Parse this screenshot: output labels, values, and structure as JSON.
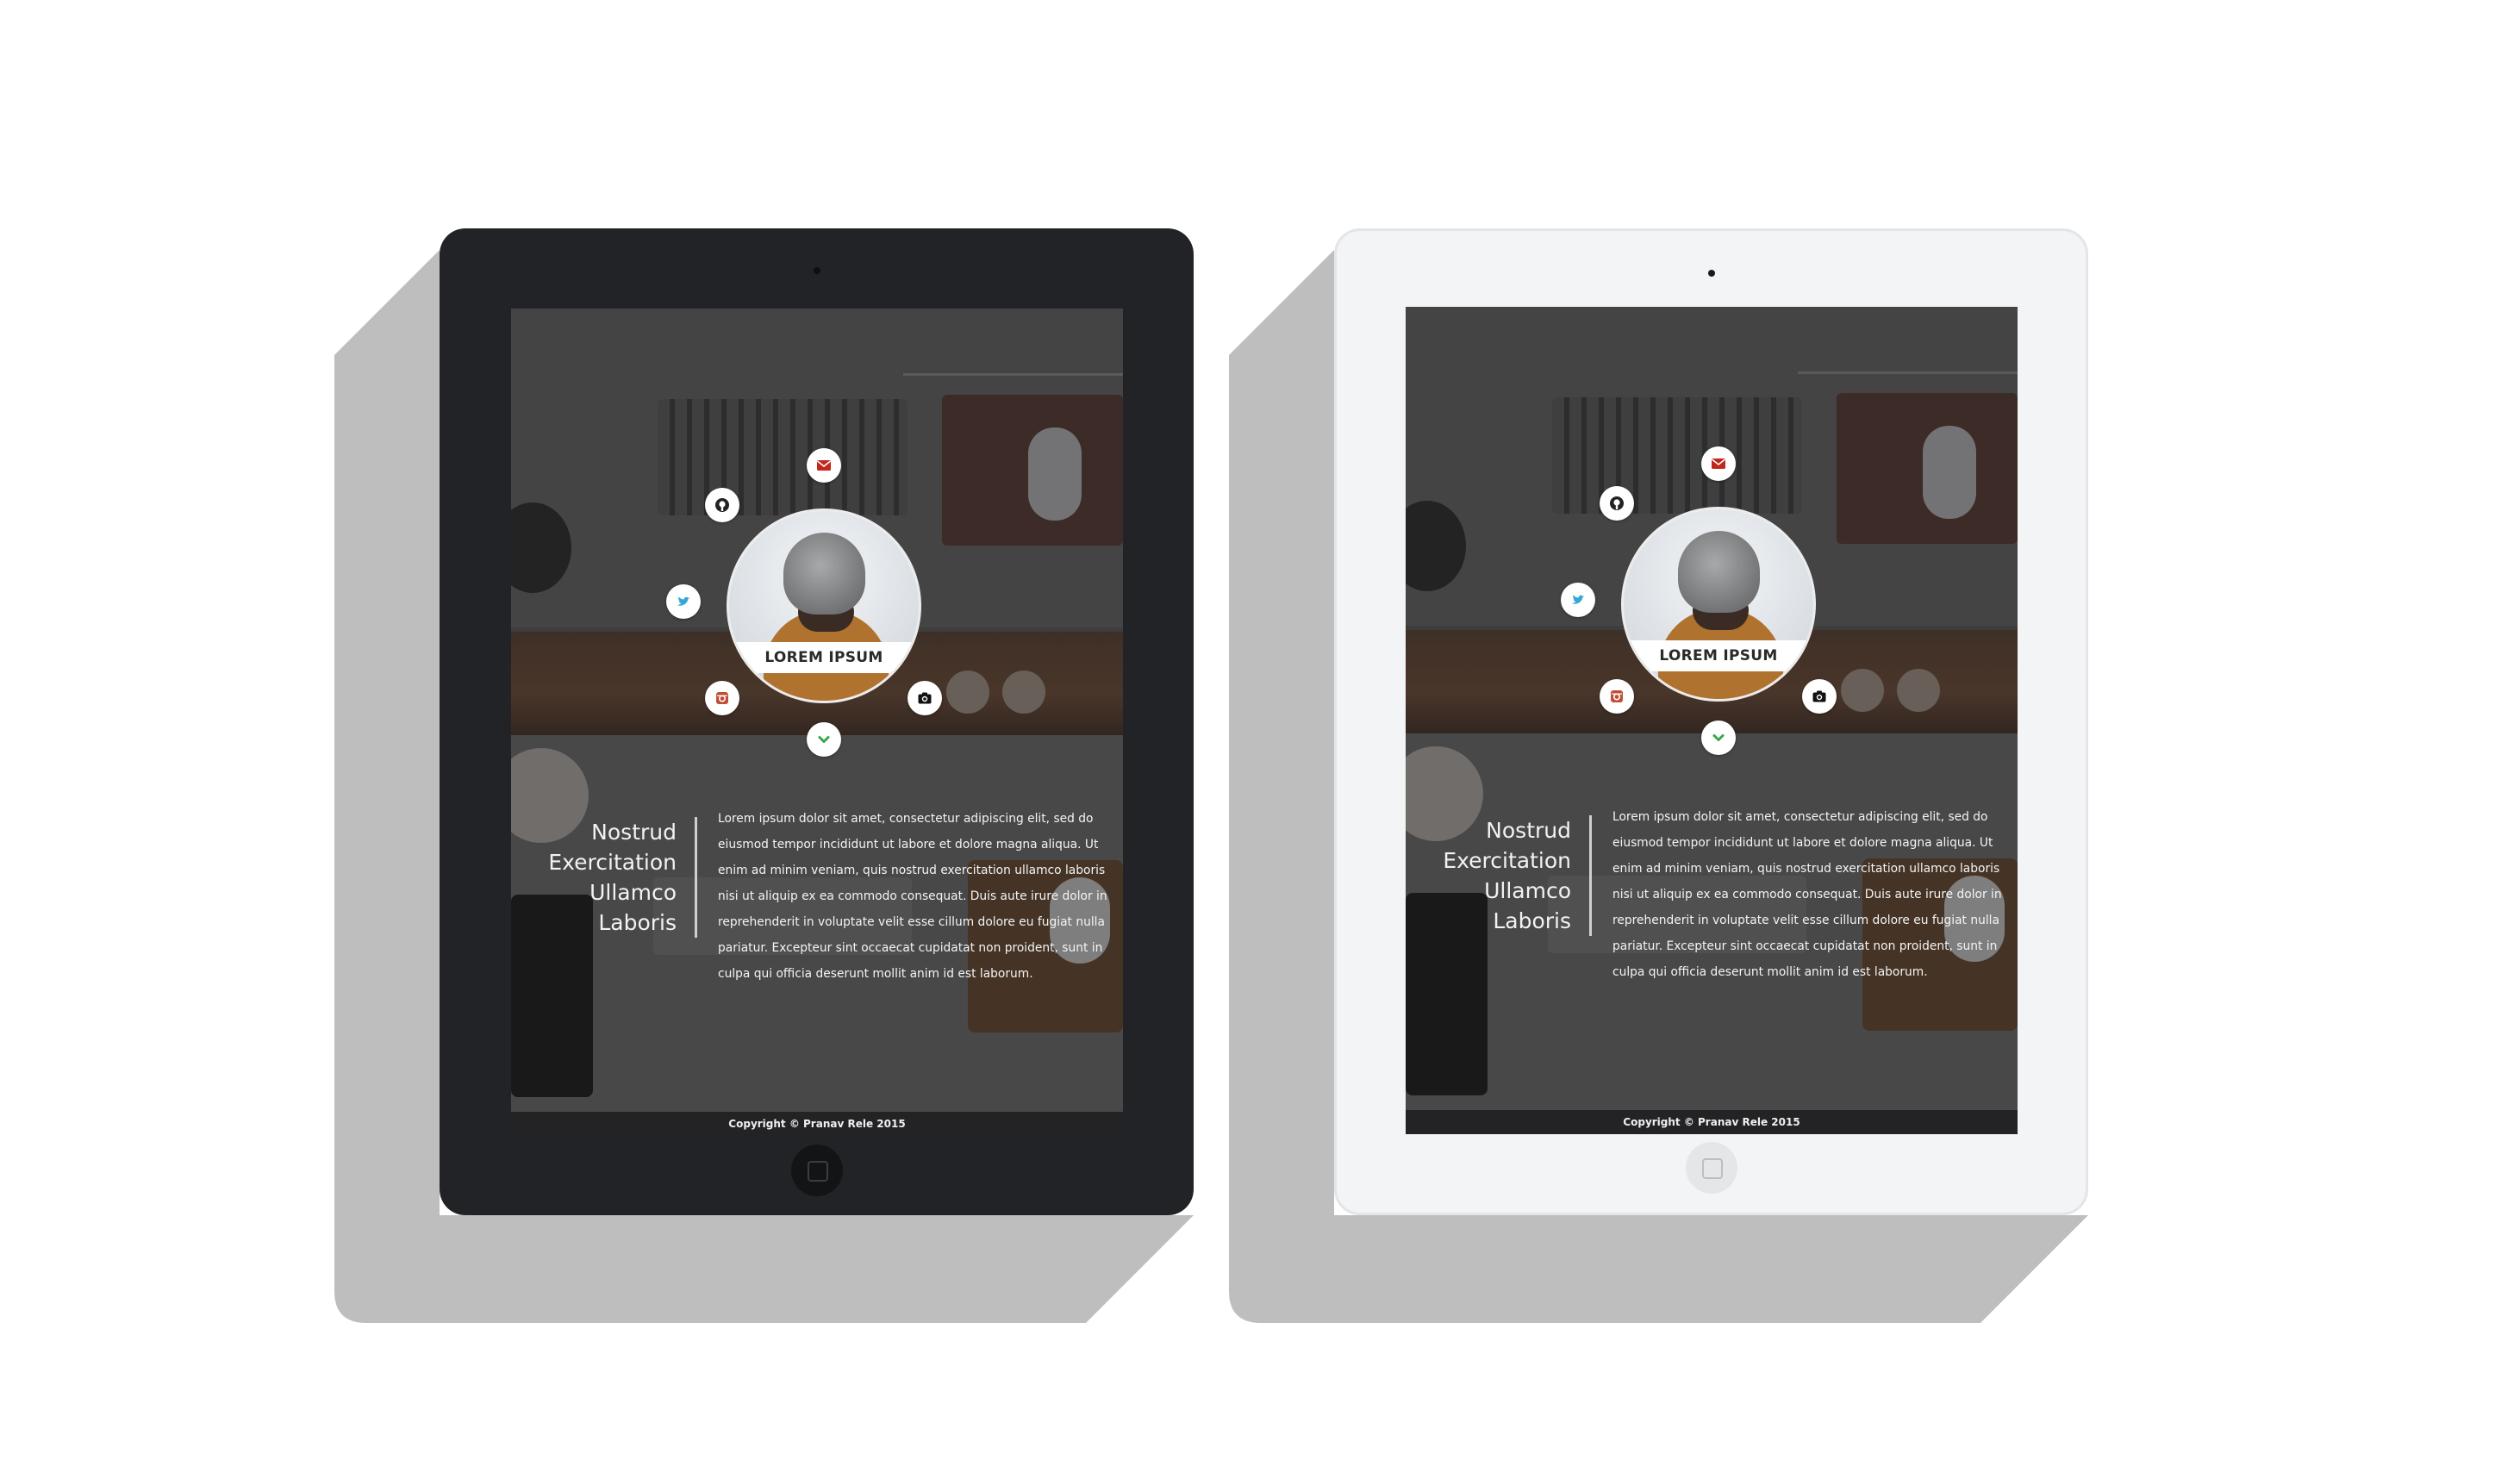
{
  "profile": {
    "name": "LOREM IPSUM"
  },
  "icons": {
    "email": "envelope-icon",
    "github": "github-icon",
    "twitter": "twitter-icon",
    "instagram": "instagram-icon",
    "camera": "camera-icon",
    "scroll": "chevron-down-icon"
  },
  "intro": {
    "headline_lines": [
      "Nostrud",
      "Exercitation",
      "Ullamco",
      "Laboris"
    ],
    "body": "Lorem ipsum dolor sit amet, consectetur adipiscing elit, sed do eiusmod tempor incididunt ut labore et dolore magna aliqua. Ut enim ad minim veniam, quis nostrud exercitation ullamco laboris nisi ut aliquip ex ea commodo consequat. Duis aute irure dolor in reprehenderit in voluptate velit esse cillum dolore eu fugiat nulla pariatur. Excepteur sint occaecat cupidatat non proident, sunt in culpa qui officia deserunt mollit anim id est laborum."
  },
  "footer": {
    "copyright": "Copyright © Pranav Rele 2015"
  },
  "colors": {
    "email_accent": "#c0281d",
    "twitter_accent": "#35a6d8",
    "instagram_accent": "#c24d37",
    "chevron_accent": "#3aa64b",
    "tablet_black": "#222327",
    "tablet_white": "#f3f4f6",
    "shadow": "#bfbebf"
  },
  "devices": [
    "black-tablet",
    "white-tablet"
  ]
}
